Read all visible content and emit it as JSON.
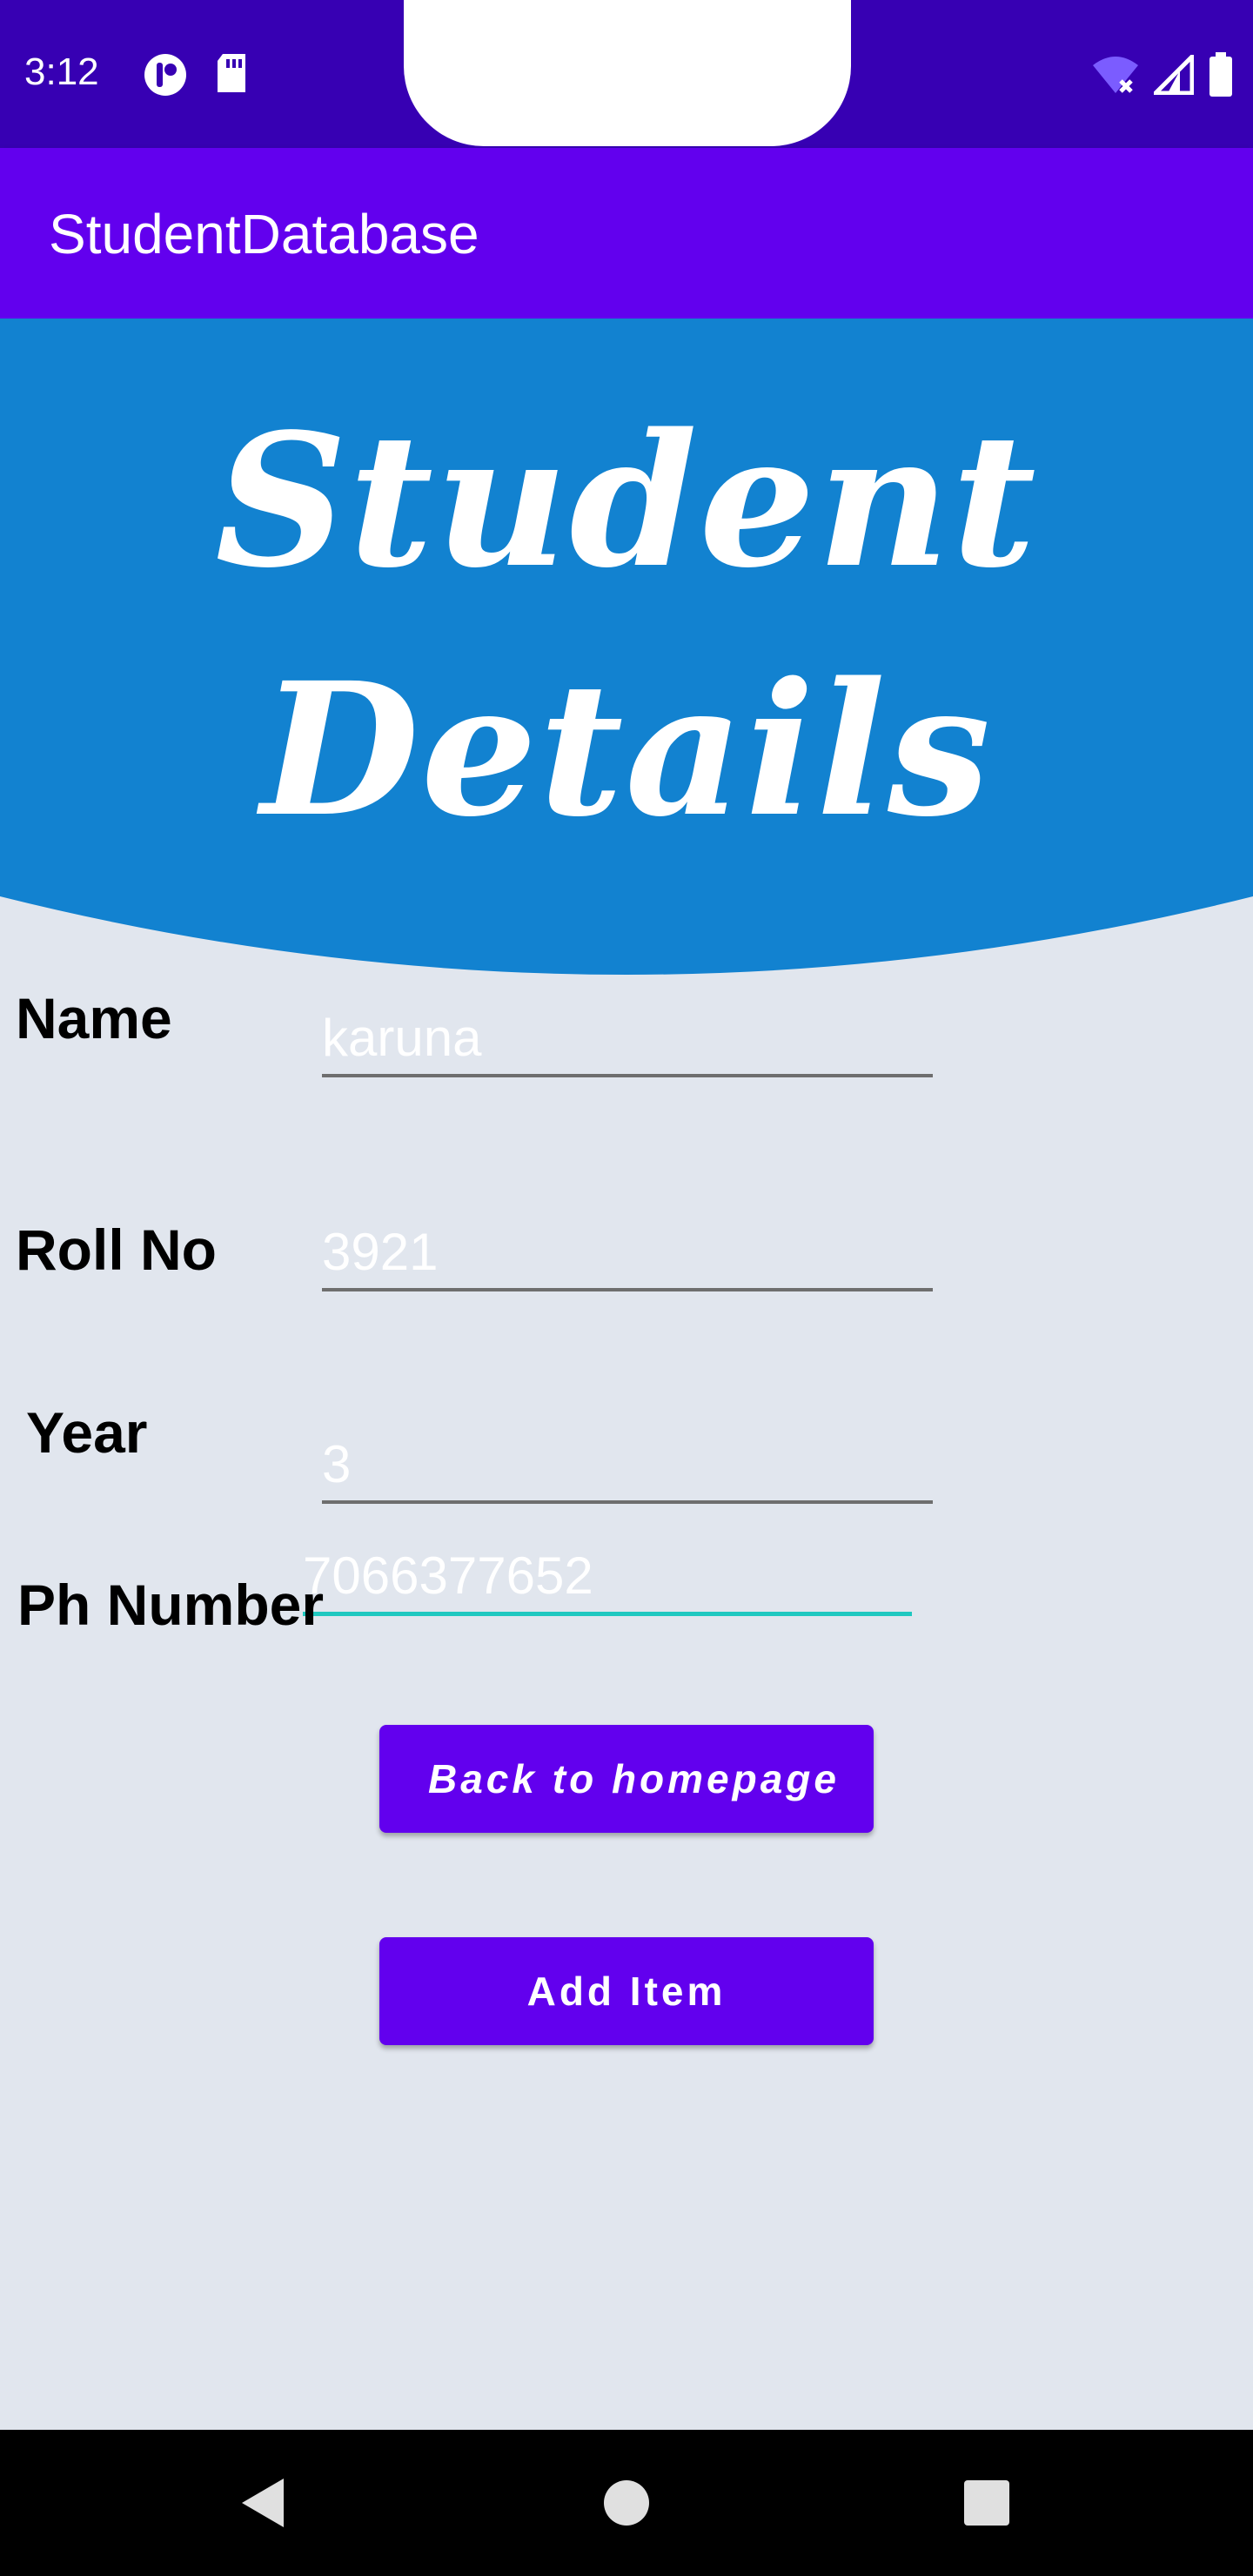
{
  "status_bar": {
    "time": "3:12",
    "left_icons": [
      "app-circle-icon",
      "sd-card-icon"
    ],
    "right_icons": [
      "wifi-off-icon",
      "signal-icon",
      "battery-icon"
    ]
  },
  "app_bar": {
    "title": "StudentDatabase"
  },
  "header": {
    "line1": "Student",
    "line2": "Details",
    "color": "#1282d0"
  },
  "form": {
    "name_label": "Name",
    "name_value": "karuna",
    "roll_label": "Roll No",
    "roll_value": "3921",
    "year_label": "Year",
    "year_value": "3",
    "phone_label": "Ph Number",
    "phone_value": "7066377652"
  },
  "buttons": {
    "back_label": "Back to homepage",
    "add_label": "Add Item"
  },
  "colors": {
    "accent": "#6200ee",
    "status_bar": "#3700b3",
    "focused_underline": "#1fc8c0",
    "background": "#e1e6ee"
  },
  "nav_bar": {
    "icons": [
      "back-icon",
      "home-icon",
      "recents-icon"
    ]
  }
}
